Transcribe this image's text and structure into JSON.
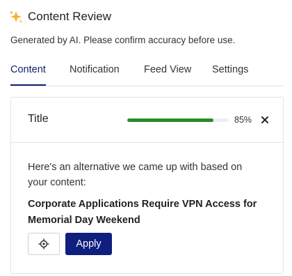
{
  "header": {
    "icon": "sparkle-icon",
    "title": "Content Review"
  },
  "disclaimer": "Generated by AI. Please confirm accuracy before use.",
  "tabs": [
    {
      "label": "Content",
      "active": true
    },
    {
      "label": "Notification",
      "active": false
    },
    {
      "label": "Feed View",
      "active": false
    },
    {
      "label": "Settings",
      "active": false
    }
  ],
  "card": {
    "title": "Title",
    "progress_percent": 85,
    "progress_label": "85%",
    "close_icon": "close-icon",
    "intro": "Here's an alternative we came up with based on your content:",
    "suggestion": "Corporate Applications Require VPN Access for Memorial Day Weekend",
    "locate_icon": "crosshair-icon",
    "apply_label": "Apply"
  },
  "colors": {
    "accent": "#0e1f7d",
    "progress": "#2b8a2b"
  }
}
